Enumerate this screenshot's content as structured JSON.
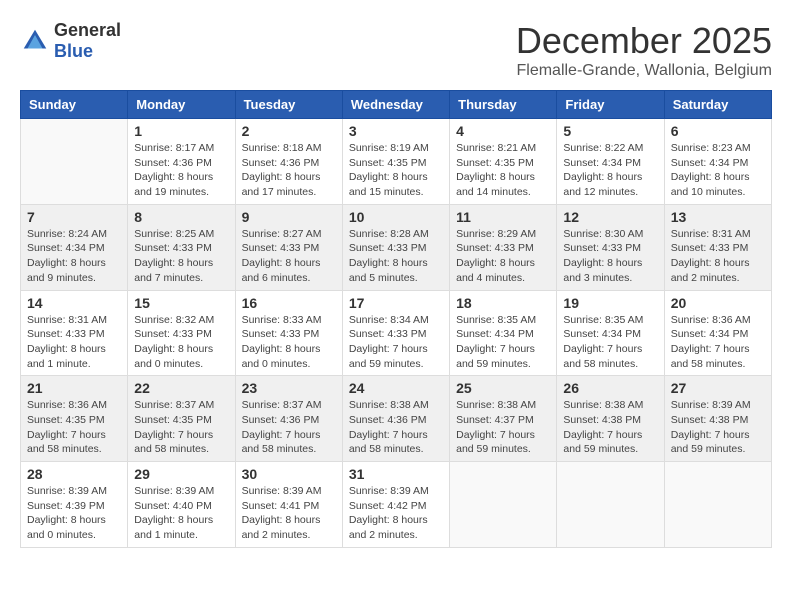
{
  "logo": {
    "general": "General",
    "blue": "Blue"
  },
  "title": {
    "month": "December 2025",
    "location": "Flemalle-Grande, Wallonia, Belgium"
  },
  "weekdays": [
    "Sunday",
    "Monday",
    "Tuesday",
    "Wednesday",
    "Thursday",
    "Friday",
    "Saturday"
  ],
  "weeks": [
    [
      {
        "day": "",
        "sunrise": "",
        "sunset": "",
        "daylight": ""
      },
      {
        "day": "1",
        "sunrise": "Sunrise: 8:17 AM",
        "sunset": "Sunset: 4:36 PM",
        "daylight": "Daylight: 8 hours and 19 minutes."
      },
      {
        "day": "2",
        "sunrise": "Sunrise: 8:18 AM",
        "sunset": "Sunset: 4:36 PM",
        "daylight": "Daylight: 8 hours and 17 minutes."
      },
      {
        "day": "3",
        "sunrise": "Sunrise: 8:19 AM",
        "sunset": "Sunset: 4:35 PM",
        "daylight": "Daylight: 8 hours and 15 minutes."
      },
      {
        "day": "4",
        "sunrise": "Sunrise: 8:21 AM",
        "sunset": "Sunset: 4:35 PM",
        "daylight": "Daylight: 8 hours and 14 minutes."
      },
      {
        "day": "5",
        "sunrise": "Sunrise: 8:22 AM",
        "sunset": "Sunset: 4:34 PM",
        "daylight": "Daylight: 8 hours and 12 minutes."
      },
      {
        "day": "6",
        "sunrise": "Sunrise: 8:23 AM",
        "sunset": "Sunset: 4:34 PM",
        "daylight": "Daylight: 8 hours and 10 minutes."
      }
    ],
    [
      {
        "day": "7",
        "sunrise": "Sunrise: 8:24 AM",
        "sunset": "Sunset: 4:34 PM",
        "daylight": "Daylight: 8 hours and 9 minutes."
      },
      {
        "day": "8",
        "sunrise": "Sunrise: 8:25 AM",
        "sunset": "Sunset: 4:33 PM",
        "daylight": "Daylight: 8 hours and 7 minutes."
      },
      {
        "day": "9",
        "sunrise": "Sunrise: 8:27 AM",
        "sunset": "Sunset: 4:33 PM",
        "daylight": "Daylight: 8 hours and 6 minutes."
      },
      {
        "day": "10",
        "sunrise": "Sunrise: 8:28 AM",
        "sunset": "Sunset: 4:33 PM",
        "daylight": "Daylight: 8 hours and 5 minutes."
      },
      {
        "day": "11",
        "sunrise": "Sunrise: 8:29 AM",
        "sunset": "Sunset: 4:33 PM",
        "daylight": "Daylight: 8 hours and 4 minutes."
      },
      {
        "day": "12",
        "sunrise": "Sunrise: 8:30 AM",
        "sunset": "Sunset: 4:33 PM",
        "daylight": "Daylight: 8 hours and 3 minutes."
      },
      {
        "day": "13",
        "sunrise": "Sunrise: 8:31 AM",
        "sunset": "Sunset: 4:33 PM",
        "daylight": "Daylight: 8 hours and 2 minutes."
      }
    ],
    [
      {
        "day": "14",
        "sunrise": "Sunrise: 8:31 AM",
        "sunset": "Sunset: 4:33 PM",
        "daylight": "Daylight: 8 hours and 1 minute."
      },
      {
        "day": "15",
        "sunrise": "Sunrise: 8:32 AM",
        "sunset": "Sunset: 4:33 PM",
        "daylight": "Daylight: 8 hours and 0 minutes."
      },
      {
        "day": "16",
        "sunrise": "Sunrise: 8:33 AM",
        "sunset": "Sunset: 4:33 PM",
        "daylight": "Daylight: 8 hours and 0 minutes."
      },
      {
        "day": "17",
        "sunrise": "Sunrise: 8:34 AM",
        "sunset": "Sunset: 4:33 PM",
        "daylight": "Daylight: 7 hours and 59 minutes."
      },
      {
        "day": "18",
        "sunrise": "Sunrise: 8:35 AM",
        "sunset": "Sunset: 4:34 PM",
        "daylight": "Daylight: 7 hours and 59 minutes."
      },
      {
        "day": "19",
        "sunrise": "Sunrise: 8:35 AM",
        "sunset": "Sunset: 4:34 PM",
        "daylight": "Daylight: 7 hours and 58 minutes."
      },
      {
        "day": "20",
        "sunrise": "Sunrise: 8:36 AM",
        "sunset": "Sunset: 4:34 PM",
        "daylight": "Daylight: 7 hours and 58 minutes."
      }
    ],
    [
      {
        "day": "21",
        "sunrise": "Sunrise: 8:36 AM",
        "sunset": "Sunset: 4:35 PM",
        "daylight": "Daylight: 7 hours and 58 minutes."
      },
      {
        "day": "22",
        "sunrise": "Sunrise: 8:37 AM",
        "sunset": "Sunset: 4:35 PM",
        "daylight": "Daylight: 7 hours and 58 minutes."
      },
      {
        "day": "23",
        "sunrise": "Sunrise: 8:37 AM",
        "sunset": "Sunset: 4:36 PM",
        "daylight": "Daylight: 7 hours and 58 minutes."
      },
      {
        "day": "24",
        "sunrise": "Sunrise: 8:38 AM",
        "sunset": "Sunset: 4:36 PM",
        "daylight": "Daylight: 7 hours and 58 minutes."
      },
      {
        "day": "25",
        "sunrise": "Sunrise: 8:38 AM",
        "sunset": "Sunset: 4:37 PM",
        "daylight": "Daylight: 7 hours and 59 minutes."
      },
      {
        "day": "26",
        "sunrise": "Sunrise: 8:38 AM",
        "sunset": "Sunset: 4:38 PM",
        "daylight": "Daylight: 7 hours and 59 minutes."
      },
      {
        "day": "27",
        "sunrise": "Sunrise: 8:39 AM",
        "sunset": "Sunset: 4:38 PM",
        "daylight": "Daylight: 7 hours and 59 minutes."
      }
    ],
    [
      {
        "day": "28",
        "sunrise": "Sunrise: 8:39 AM",
        "sunset": "Sunset: 4:39 PM",
        "daylight": "Daylight: 8 hours and 0 minutes."
      },
      {
        "day": "29",
        "sunrise": "Sunrise: 8:39 AM",
        "sunset": "Sunset: 4:40 PM",
        "daylight": "Daylight: 8 hours and 1 minute."
      },
      {
        "day": "30",
        "sunrise": "Sunrise: 8:39 AM",
        "sunset": "Sunset: 4:41 PM",
        "daylight": "Daylight: 8 hours and 2 minutes."
      },
      {
        "day": "31",
        "sunrise": "Sunrise: 8:39 AM",
        "sunset": "Sunset: 4:42 PM",
        "daylight": "Daylight: 8 hours and 2 minutes."
      },
      {
        "day": "",
        "sunrise": "",
        "sunset": "",
        "daylight": ""
      },
      {
        "day": "",
        "sunrise": "",
        "sunset": "",
        "daylight": ""
      },
      {
        "day": "",
        "sunrise": "",
        "sunset": "",
        "daylight": ""
      }
    ]
  ]
}
